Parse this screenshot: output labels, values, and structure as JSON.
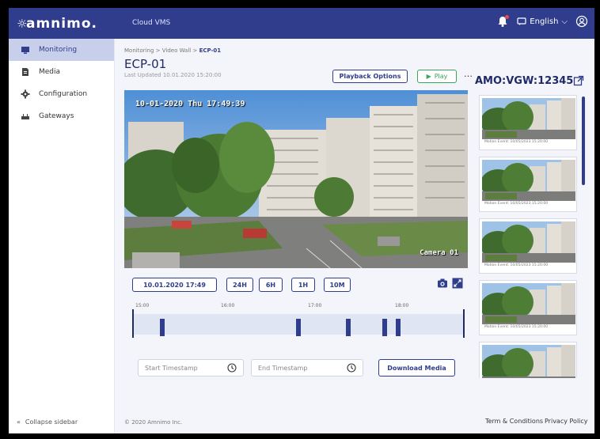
{
  "topbar": {
    "logo": "amnimo.",
    "app_name": "Cloud VMS",
    "language": "English",
    "bell_icon": "bell-icon",
    "user_icon": "user-icon",
    "accent": "#2f3d8c"
  },
  "sidebar": {
    "items": [
      {
        "label": "Monitoring",
        "icon": "monitor-icon",
        "active": true
      },
      {
        "label": "Media",
        "icon": "file-icon",
        "active": false
      },
      {
        "label": "Configuration",
        "icon": "gear-icon",
        "active": false
      },
      {
        "label": "Gateways",
        "icon": "gateway-icon",
        "active": false
      }
    ],
    "collapse_label": "Collapse sidebar"
  },
  "breadcrumb": {
    "path": "Monitoring > Video Wall > ",
    "current": "ECP-01"
  },
  "page": {
    "title": "ECP-01",
    "last_updated": "Last Updated 10.01.2020 15:20:00",
    "playback_options": "Playback Options",
    "play_label": "Play",
    "more": "…",
    "camera_id": "AMO:VGW:12345"
  },
  "video": {
    "osd_timestamp": "10-01-2020 Thu 17:49:39",
    "camera_label": "Camera 01"
  },
  "controls": {
    "datetime": "10.01.2020  17:49",
    "ranges": [
      "24H",
      "6H",
      "1H",
      "10M"
    ],
    "camera_icon": "camera-icon",
    "fullscreen_icon": "expand-icon"
  },
  "timeline": {
    "ticks": [
      "15:00",
      "16:00",
      "17:00",
      "18:00"
    ],
    "markers": [
      0.09,
      0.5,
      0.65,
      0.76,
      0.8
    ]
  },
  "download": {
    "start_placeholder": "Start Timestamp",
    "end_placeholder": "End Timestamp",
    "button": "Download Media"
  },
  "events": [
    {
      "caption": "Motion Event: 10/05/2023 15:20:00"
    },
    {
      "caption": "Motion Event: 10/05/2023 15:20:00"
    },
    {
      "caption": "Motion Event: 10/05/2023 15:20:00"
    },
    {
      "caption": "Motion Event: 10/05/2023 15:20:00"
    },
    {
      "caption": ""
    }
  ],
  "footer": {
    "copyright": "© 2020 Amnimo Inc.",
    "terms": "Term & Conditions",
    "privacy": "Privacy Policy"
  }
}
